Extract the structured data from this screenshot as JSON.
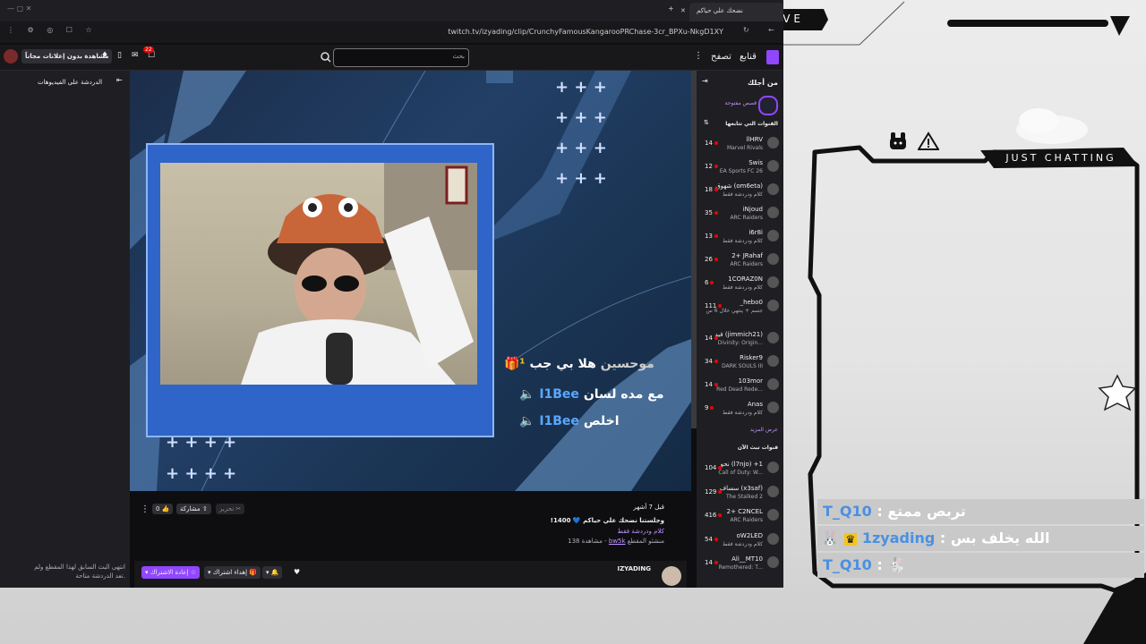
{
  "browser": {
    "tab_title": "نضحك علي حياكم",
    "url": "twitch.tv/izyading/clip/CrunchyFamousKangarooPRChase-3cr_BPXu-NkgD1XY"
  },
  "header": {
    "follow_label": "قنابع",
    "browse_label": "تصفح",
    "search_placeholder": "بحث",
    "ad_free_label": "مشاهدة بدون إعلانات مجاناً",
    "notifications_count": "22"
  },
  "left_panel": {
    "chat_on_videos": "الدردشة على الفيديوهات",
    "stream_ended_text": "انتهى البث السابق لهذا المقطع ولم تعد الدردشة متاحة."
  },
  "sidebar": {
    "for_you": "من أجلك",
    "open_cases": "قصص مفتوحة",
    "followed_header": "القنوات التي تتابعها",
    "show_more": "عرض المزيد",
    "live_channels_header": "قنوات تبث الآن",
    "followed_channels": [
      {
        "name": "llHRV",
        "game": "Marvel Rivals",
        "viewers": "14"
      },
      {
        "name": "Swis",
        "game": "EA Sports FC 26",
        "viewers": "12"
      },
      {
        "name": "شهوق (om6eta)",
        "game": "كلام ودردشة فقط",
        "viewers": "18"
      },
      {
        "name": "iNjoud",
        "game": "ARC Raiders",
        "viewers": "35"
      },
      {
        "name": "i6r8i",
        "game": "كلام ودردشة فقط",
        "viewers": "13"
      },
      {
        "name": "2+ JRahaf",
        "game": "ARC Raiders",
        "viewers": "26"
      },
      {
        "name": "1CORAZ0N",
        "game": "كلام ودردشة فقط",
        "viewers": "6"
      },
      {
        "name": "_hebo0",
        "game": "جسم + ينتهي خلال 6 س",
        "viewers": "111"
      },
      {
        "name": "فيد (jimmich21)",
        "game": "Divinity: Origin...",
        "viewers": "14"
      },
      {
        "name": "Risker9",
        "game": "DARK SOULS III",
        "viewers": "34"
      },
      {
        "name": "103mor",
        "game": "Red Dead Rede...",
        "viewers": "14"
      },
      {
        "name": "Anas",
        "game": "كلام ودردشة فقط",
        "viewers": "9"
      }
    ],
    "live_channels": [
      {
        "name": "نحو (l7njo) +1",
        "game": "Call of Duty: W...",
        "viewers": "104"
      },
      {
        "name": "سساف (x3saf)",
        "game": "The Stalked 2",
        "viewers": "129"
      },
      {
        "name": "2+ C2NCEL",
        "game": "ARC Raiders",
        "viewers": "416"
      },
      {
        "name": "oW2LED",
        "game": "كلام ودردشة فقط",
        "viewers": "54"
      },
      {
        "name": "Ali__MT10",
        "game": "Remothered: T...",
        "viewers": "14"
      }
    ]
  },
  "video_chat": {
    "line1_text": "هلا بي جب",
    "line1_user": "موحسين",
    "line2_text": "مع مده لسان",
    "line2_user": "I1Bee",
    "line3_text": "اخلص",
    "line3_user": "I1Bee"
  },
  "clip_info": {
    "time_ago": "قبل 7 أشهر",
    "title": "وجلستنا نضحك علي حياكم",
    "title_suffix": "!1400",
    "category": "كلام ودردشة فقط",
    "clipped_by": "منشئو المقطع",
    "clipper": "bw5k",
    "views": "138 مشاهدة",
    "likes": "0",
    "share_label": "مشاركة",
    "edit_label": "تحرير",
    "channel": "IZYADING",
    "gift_label": "إهداء اشتراك",
    "resub_label": "إعادة الاشتراك"
  },
  "overlay": {
    "live_label": "LIVE",
    "category_label": "JUST CHATTING",
    "chat": [
      {
        "user": "T_Q10",
        "message": "تربص ممتع"
      },
      {
        "user": "1zyading",
        "message": "الله يخلف بس"
      },
      {
        "user": "T_Q10",
        "message": ""
      }
    ]
  },
  "colors": {
    "twitch_purple": "#9147ff",
    "live_red": "#eb0400",
    "nick_blue": "#4a90e2"
  }
}
